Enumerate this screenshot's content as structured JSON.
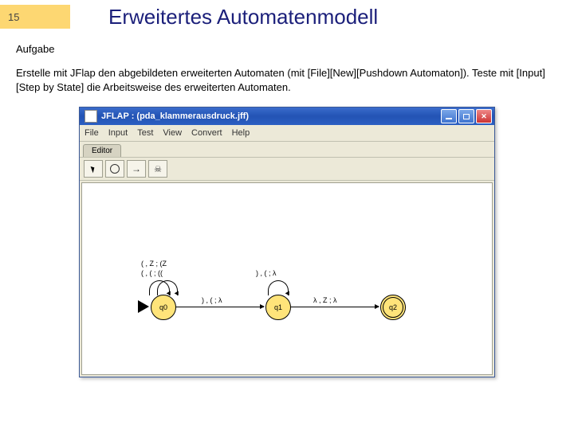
{
  "slide": {
    "number": "15",
    "title": "Erweitertes Automatenmodell",
    "section_label": "Aufgabe",
    "task_text": "Erstelle mit JFlap den abgebildeten erweiterten Automaten (mit [File][New][Pushdown Automaton]). Teste mit [Input][Step by State] die Arbeitsweise des erweiterten Automaten."
  },
  "jflap": {
    "titlebar": "JFLAP : (pda_klammerausdruck.jff)",
    "menu": {
      "file": "File",
      "input": "Input",
      "test": "Test",
      "view": "View",
      "convert": "Convert",
      "help": "Help"
    },
    "tab": "Editor",
    "states": {
      "q0": "q0",
      "q1": "q1",
      "q2": "q2"
    },
    "transitions": {
      "q0_loop1": "( , Z ; (Z",
      "q0_loop2": "( , ( ; ((",
      "q0_q1": ") , ( ; λ",
      "q1_loop": ") , ( ; λ",
      "q1_q2": "λ , Z ; λ"
    }
  }
}
